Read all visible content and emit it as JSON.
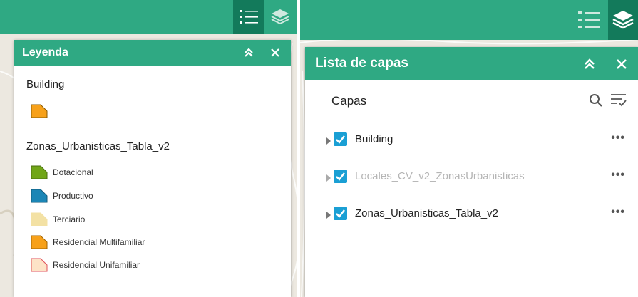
{
  "left": {
    "toolbar": {
      "legend_icon": "legend-list-icon",
      "layers_icon": "layers-stack-icon",
      "active": "legend"
    },
    "legend_panel": {
      "title": "Leyenda",
      "collapse_icon": "double-chevron-up-icon",
      "close_icon": "close-icon",
      "layers": [
        {
          "name": "Building",
          "items": [
            {
              "label": "",
              "fill": "#f7a11a",
              "stroke": "#8a5a00"
            }
          ]
        },
        {
          "name": "Zonas_Urbanisticas_Tabla_v2",
          "items": [
            {
              "label": "Dotacional",
              "fill": "#71a618",
              "stroke": "#4a6e10"
            },
            {
              "label": "Productivo",
              "fill": "#1b86b6",
              "stroke": "#12597a"
            },
            {
              "label": "Terciario",
              "fill": "#f3e1a4",
              "stroke": "#f3e1a4"
            },
            {
              "label": "Residencial Multifamiliar",
              "fill": "#f7a11a",
              "stroke": "#a16300"
            },
            {
              "label": "Residencial Unifamiliar",
              "fill": "#fde3c7",
              "stroke": "#e0505a"
            }
          ]
        }
      ]
    }
  },
  "right": {
    "toolbar": {
      "legend_icon": "legend-list-icon",
      "layers_icon": "layers-stack-icon",
      "active": "layers"
    },
    "layers_panel": {
      "title": "Lista de capas",
      "collapse_icon": "double-chevron-up-icon",
      "close_icon": "close-icon",
      "section_title": "Capas",
      "search_icon": "search-icon",
      "filter_icon": "filter-list-icon",
      "layers": [
        {
          "name": "Building",
          "checked": true,
          "dimmed": false,
          "more": "•••"
        },
        {
          "name": "Locales_CV_v2_ZonasUrbanisticas",
          "checked": true,
          "dimmed": true,
          "more": "•••"
        },
        {
          "name": "Zonas_Urbanisticas_Tabla_v2",
          "checked": true,
          "dimmed": false,
          "more": "•••"
        }
      ]
    }
  },
  "colors": {
    "header_green": "#2fa983",
    "active_button": "#137a5b",
    "checkbox_blue": "#1a9fd4",
    "dimmed_text": "#b5b5b5"
  }
}
